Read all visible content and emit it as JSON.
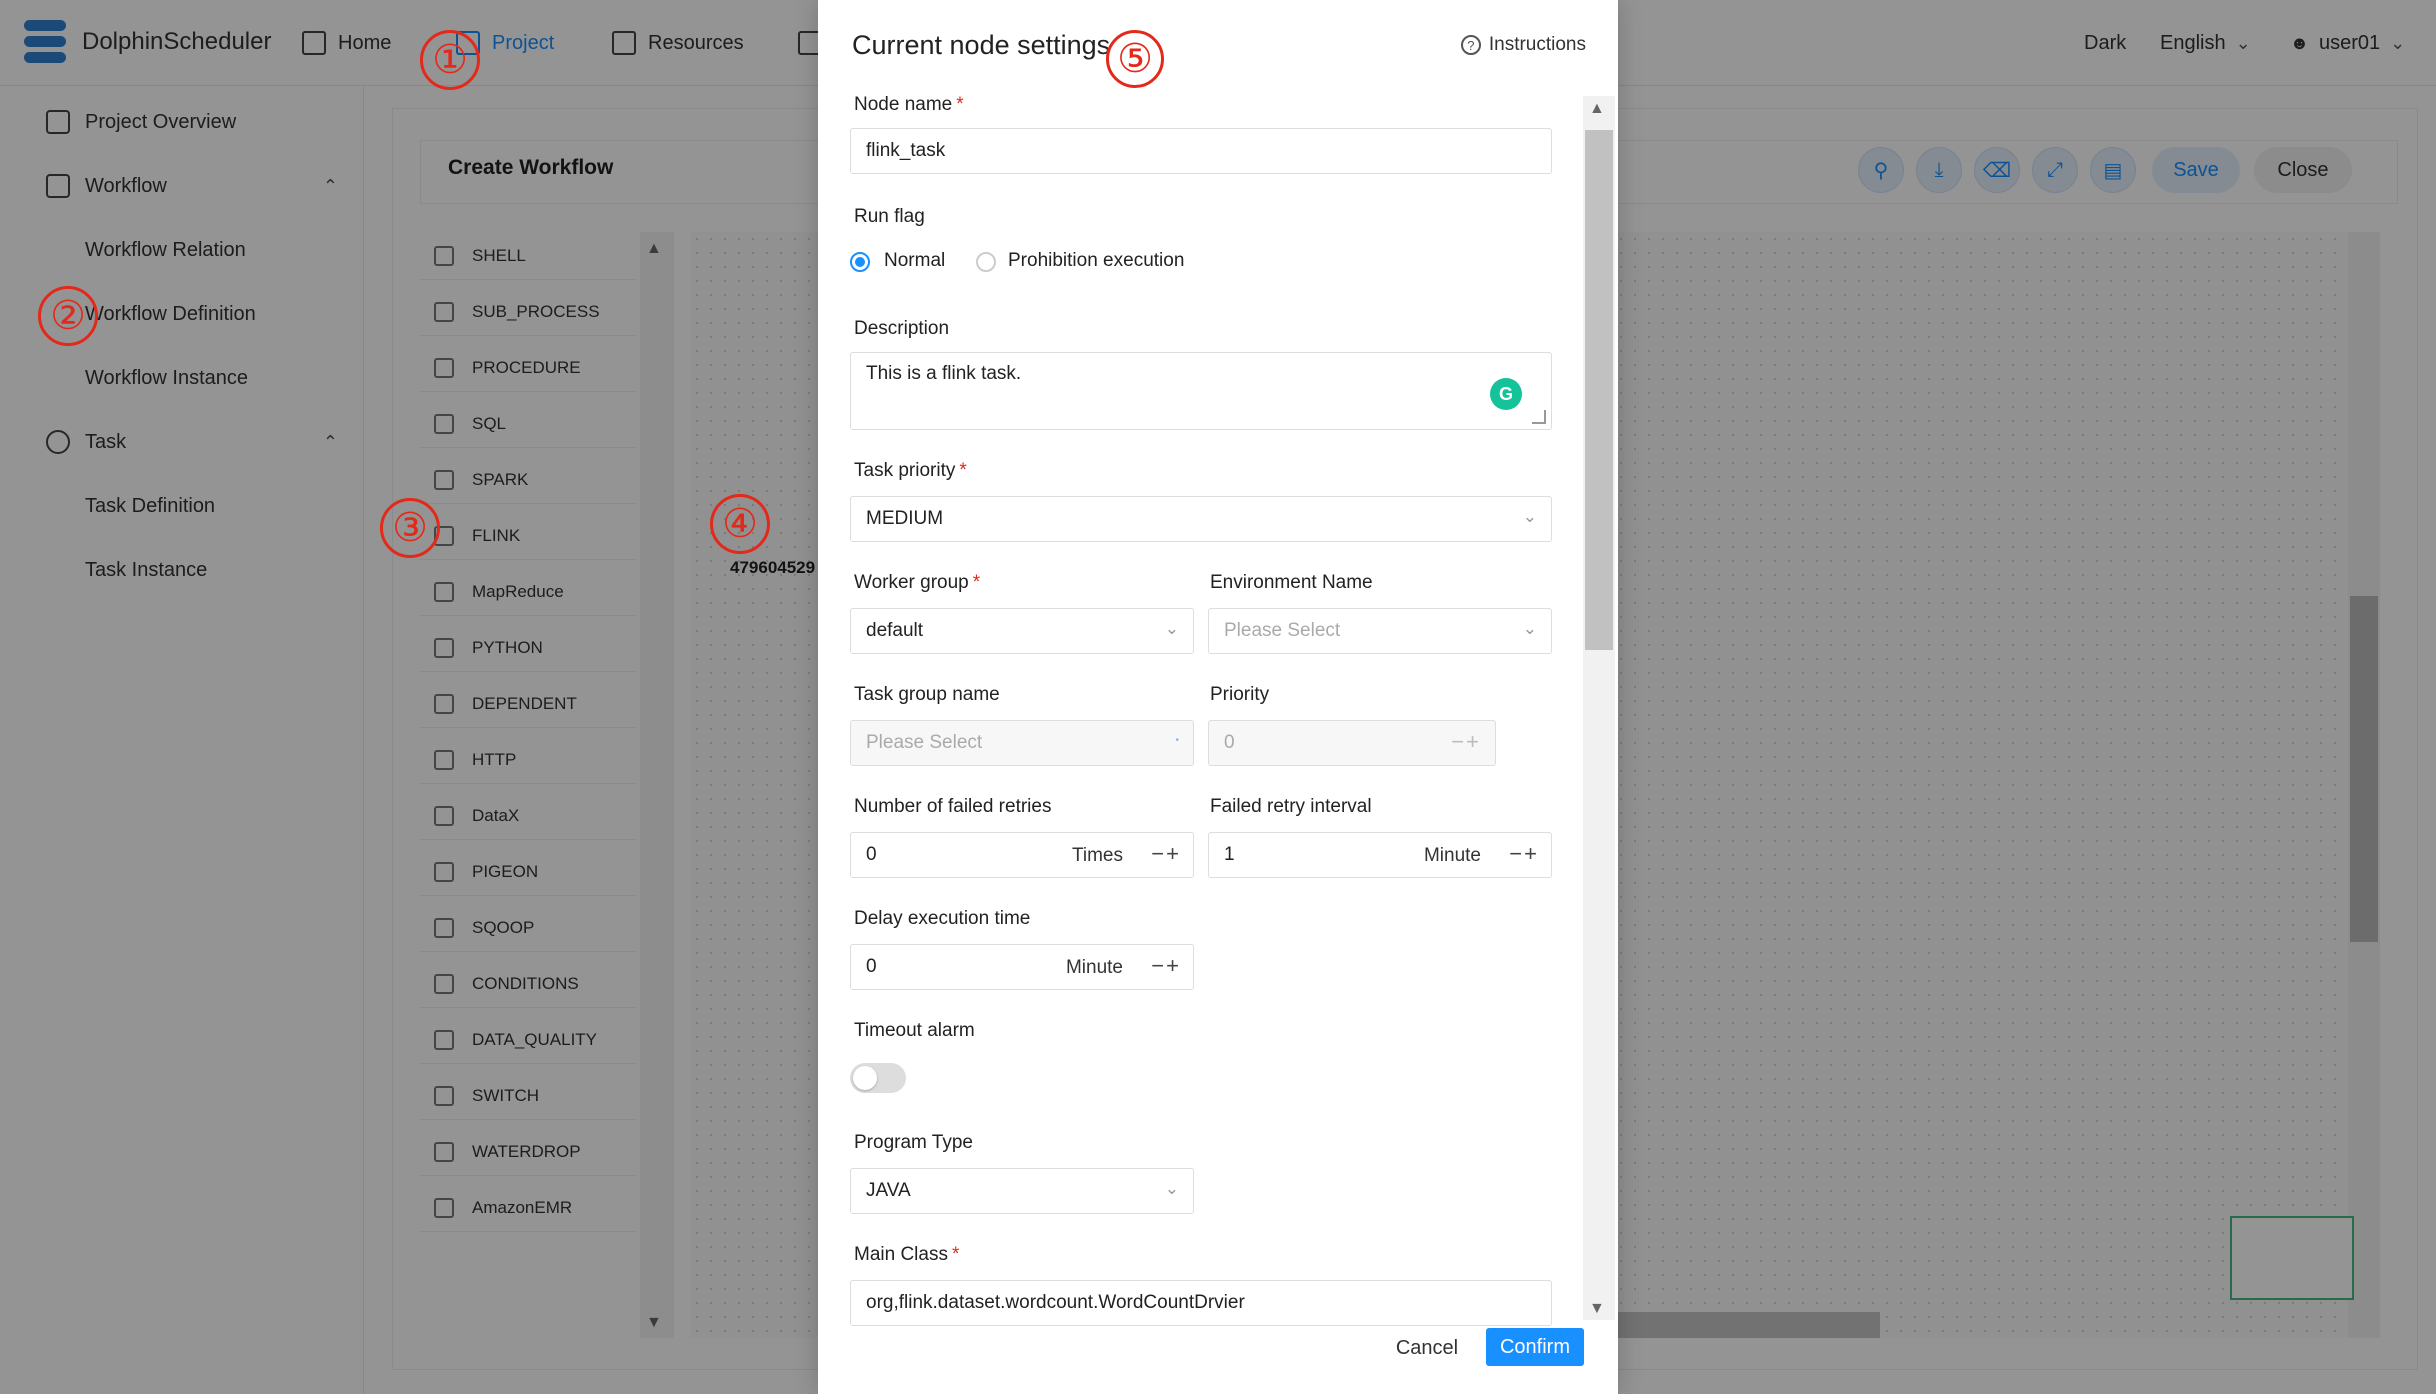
{
  "app": {
    "brand": "DolphinScheduler",
    "nav": [
      {
        "label": "Home"
      },
      {
        "label": "Project"
      },
      {
        "label": "Resources"
      }
    ],
    "theme_label": "Dark",
    "language_label": "English",
    "user_label": "user01"
  },
  "sidebar": {
    "items": [
      {
        "label": "Project Overview"
      },
      {
        "label": "Workflow"
      },
      {
        "label": "Workflow Relation"
      },
      {
        "label": "Workflow Definition"
      },
      {
        "label": "Workflow Instance"
      },
      {
        "label": "Task"
      },
      {
        "label": "Task Definition"
      },
      {
        "label": "Task Instance"
      }
    ]
  },
  "workflow": {
    "title": "Create Workflow",
    "save_label": "Save",
    "close_label": "Close",
    "node_label": "479604529",
    "palette": [
      "SHELL",
      "SUB_PROCESS",
      "PROCEDURE",
      "SQL",
      "SPARK",
      "FLINK",
      "MapReduce",
      "PYTHON",
      "DEPENDENT",
      "HTTP",
      "DataX",
      "PIGEON",
      "SQOOP",
      "CONDITIONS",
      "DATA_QUALITY",
      "SWITCH",
      "WATERDROP",
      "AmazonEMR"
    ]
  },
  "markers": [
    "①",
    "②",
    "③",
    "④",
    "⑤"
  ],
  "modal": {
    "title": "Current node settings",
    "instructions_label": "Instructions",
    "node_name": {
      "label": "Node name",
      "value": "flink_task"
    },
    "run_flag": {
      "label": "Run flag",
      "options": [
        "Normal",
        "Prohibition execution"
      ],
      "selected": "Normal"
    },
    "description": {
      "label": "Description",
      "value": "This is a flink task."
    },
    "task_priority": {
      "label": "Task priority",
      "value": "MEDIUM"
    },
    "worker_group": {
      "label": "Worker group",
      "value": "default"
    },
    "environment_name": {
      "label": "Environment Name",
      "placeholder": "Please Select"
    },
    "task_group_name": {
      "label": "Task group name",
      "placeholder": "Please Select"
    },
    "priority": {
      "label": "Priority",
      "value": "0"
    },
    "failed_retries": {
      "label": "Number of failed retries",
      "value": "0",
      "unit": "Times"
    },
    "failed_retry_interval": {
      "label": "Failed retry interval",
      "value": "1",
      "unit": "Minute"
    },
    "delay_execution_time": {
      "label": "Delay execution time",
      "value": "0",
      "unit": "Minute"
    },
    "timeout_alarm": {
      "label": "Timeout alarm",
      "enabled": false
    },
    "program_type": {
      "label": "Program Type",
      "value": "JAVA"
    },
    "main_class": {
      "label": "Main Class",
      "value": "org,flink.dataset.wordcount.WordCountDrvier"
    },
    "cancel_label": "Cancel",
    "confirm_label": "Confirm"
  },
  "colors": {
    "accent": "#1890ff",
    "marker": "#e3291a",
    "overlay": "rgba(0,0,0,0.42)",
    "grammarly": "#15c39a"
  },
  "icons": [
    "home-icon",
    "project-icon",
    "resources-icon",
    "user-icon",
    "chart-icon",
    "workflow-icon",
    "gear-icon",
    "search-icon",
    "download-icon",
    "trash-icon",
    "fullscreen-icon",
    "format-icon",
    "help-icon",
    "chevron-down-icon"
  ]
}
